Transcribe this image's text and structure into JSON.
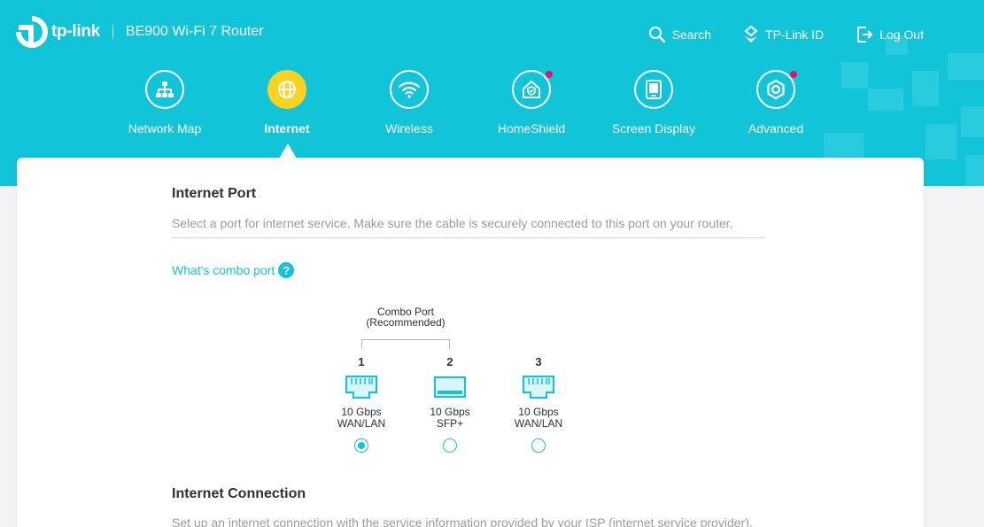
{
  "header": {
    "brand": "tp-link",
    "product": "BE900 Wi-Fi 7 Router",
    "links": [
      {
        "label": "Search",
        "icon": "search-icon"
      },
      {
        "label": "TP-Link ID",
        "icon": "tplink-id-icon"
      },
      {
        "label": "Log Out",
        "icon": "logout-icon"
      }
    ]
  },
  "nav": [
    {
      "label": "Network Map",
      "icon": "network-map-icon",
      "active": false,
      "badge": false
    },
    {
      "label": "Internet",
      "icon": "globe-icon",
      "active": true,
      "badge": false
    },
    {
      "label": "Wireless",
      "icon": "wifi-icon",
      "active": false,
      "badge": false
    },
    {
      "label": "HomeShield",
      "icon": "homeshield-icon",
      "active": false,
      "badge": true
    },
    {
      "label": "Screen Display",
      "icon": "screen-display-icon",
      "active": false,
      "badge": false
    },
    {
      "label": "Advanced",
      "icon": "gear-icon",
      "active": false,
      "badge": true
    }
  ],
  "internet_port": {
    "title": "Internet Port",
    "description": "Select a port for internet service. Make sure the cable is securely connected to this port on your router.",
    "combo_link": "What's combo port",
    "combo_label": "Combo Port",
    "combo_sub": "(Recommended)",
    "ports": [
      {
        "number": "1",
        "speed": "10 Gbps",
        "type": "WAN/LAN",
        "icon": "ethernet-port-icon",
        "selected": true
      },
      {
        "number": "2",
        "speed": "10 Gbps",
        "type": "SFP+",
        "icon": "sfp-port-icon",
        "selected": false
      },
      {
        "number": "3",
        "speed": "10 Gbps",
        "type": "WAN/LAN",
        "icon": "ethernet-port-icon",
        "selected": false
      }
    ]
  },
  "internet_connection": {
    "title": "Internet Connection",
    "description": "Set up an internet connection with the service information provided by your ISP (internet service provider)."
  },
  "colors": {
    "brand": "#12c4d8",
    "active_nav": "#ffd21f",
    "badge": "#e0126e",
    "heading": "#2d3138",
    "muted": "#999ca3"
  }
}
